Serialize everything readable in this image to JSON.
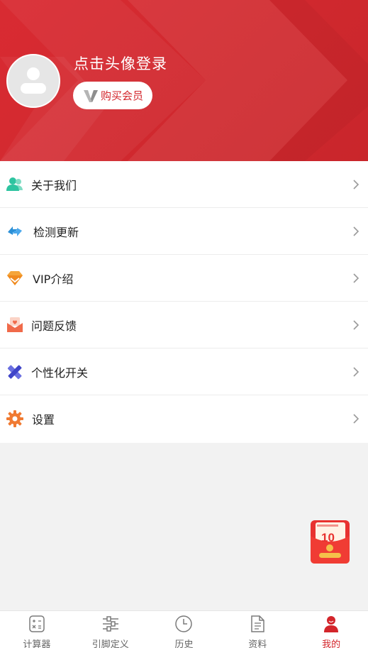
{
  "header": {
    "login_text": "点击头像登录",
    "vip_button_label": "购买会员"
  },
  "menu": {
    "items": [
      {
        "label": "关于我们",
        "icon": "users-icon"
      },
      {
        "label": "检测更新",
        "icon": "refresh-icon"
      },
      {
        "label": "VIP介绍",
        "icon": "diamond-icon"
      },
      {
        "label": "问题反馈",
        "icon": "feedback-mail-icon"
      },
      {
        "label": "个性化开关",
        "icon": "pencil-ruler-icon"
      },
      {
        "label": "设置",
        "icon": "gear-icon"
      }
    ]
  },
  "float_badge": {
    "icon": "red-envelope-icon",
    "amount": "10",
    "colors": {
      "red": "#e8322f",
      "gold": "#f5c04a"
    }
  },
  "tabbar": {
    "tabs": [
      {
        "label": "计算器",
        "icon": "calculator-icon",
        "active": false
      },
      {
        "label": "引脚定义",
        "icon": "sliders-icon",
        "active": false
      },
      {
        "label": "历史",
        "icon": "clock-icon",
        "active": false
      },
      {
        "label": "资料",
        "icon": "document-icon",
        "active": false
      },
      {
        "label": "我的",
        "icon": "person-icon",
        "active": true
      }
    ]
  },
  "colors": {
    "brand_red": "#d3252b",
    "text_dark": "#222222",
    "text_muted": "#666666",
    "background": "#f2f2f2"
  }
}
